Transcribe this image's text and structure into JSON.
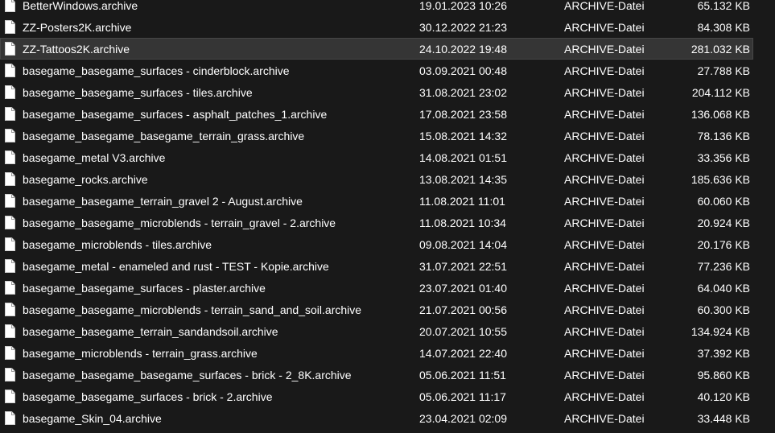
{
  "files": [
    {
      "name": "BetterWindows.archive",
      "date": "19.01.2023 10:26",
      "type": "ARCHIVE-Datei",
      "size": "65.132 KB",
      "selected": false
    },
    {
      "name": "ZZ-Posters2K.archive",
      "date": "30.12.2022 21:23",
      "type": "ARCHIVE-Datei",
      "size": "84.308 KB",
      "selected": false
    },
    {
      "name": "ZZ-Tattoos2K.archive",
      "date": "24.10.2022 19:48",
      "type": "ARCHIVE-Datei",
      "size": "281.032 KB",
      "selected": true
    },
    {
      "name": "basegame_basegame_surfaces - cinderblock.archive",
      "date": "03.09.2021 00:48",
      "type": "ARCHIVE-Datei",
      "size": "27.788 KB",
      "selected": false
    },
    {
      "name": "basegame_basegame_surfaces - tiles.archive",
      "date": "31.08.2021 23:02",
      "type": "ARCHIVE-Datei",
      "size": "204.112 KB",
      "selected": false
    },
    {
      "name": "basegame_basegame_surfaces - asphalt_patches_1.archive",
      "date": "17.08.2021 23:58",
      "type": "ARCHIVE-Datei",
      "size": "136.068 KB",
      "selected": false
    },
    {
      "name": "basegame_basegame_basegame_terrain_grass.archive",
      "date": "15.08.2021 14:32",
      "type": "ARCHIVE-Datei",
      "size": "78.136 KB",
      "selected": false
    },
    {
      "name": "basegame_metal V3.archive",
      "date": "14.08.2021 01:51",
      "type": "ARCHIVE-Datei",
      "size": "33.356 KB",
      "selected": false
    },
    {
      "name": "basegame_rocks.archive",
      "date": "13.08.2021 14:35",
      "type": "ARCHIVE-Datei",
      "size": "185.636 KB",
      "selected": false
    },
    {
      "name": "basegame_basegame_terrain_gravel 2 - August.archive",
      "date": "11.08.2021 11:01",
      "type": "ARCHIVE-Datei",
      "size": "60.060 KB",
      "selected": false
    },
    {
      "name": "basegame_basegame_microblends - terrain_gravel - 2.archive",
      "date": "11.08.2021 10:34",
      "type": "ARCHIVE-Datei",
      "size": "20.924 KB",
      "selected": false
    },
    {
      "name": "basegame_microblends - tiles.archive",
      "date": "09.08.2021 14:04",
      "type": "ARCHIVE-Datei",
      "size": "20.176 KB",
      "selected": false
    },
    {
      "name": "basegame_metal - enameled and rust - TEST - Kopie.archive",
      "date": "31.07.2021 22:51",
      "type": "ARCHIVE-Datei",
      "size": "77.236 KB",
      "selected": false
    },
    {
      "name": "basegame_basegame_surfaces - plaster.archive",
      "date": "23.07.2021 01:40",
      "type": "ARCHIVE-Datei",
      "size": "64.040 KB",
      "selected": false
    },
    {
      "name": "basegame_basegame_microblends - terrain_sand_and_soil.archive",
      "date": "21.07.2021 00:56",
      "type": "ARCHIVE-Datei",
      "size": "60.300 KB",
      "selected": false
    },
    {
      "name": "basegame_basegame_terrain_sandandsoil.archive",
      "date": "20.07.2021 10:55",
      "type": "ARCHIVE-Datei",
      "size": "134.924 KB",
      "selected": false
    },
    {
      "name": "basegame_microblends - terrain_grass.archive",
      "date": "14.07.2021 22:40",
      "type": "ARCHIVE-Datei",
      "size": "37.392 KB",
      "selected": false
    },
    {
      "name": "basegame_basegame_basegame_surfaces - brick - 2_8K.archive",
      "date": "05.06.2021 11:51",
      "type": "ARCHIVE-Datei",
      "size": "95.860 KB",
      "selected": false
    },
    {
      "name": "basegame_basegame_surfaces - brick - 2.archive",
      "date": "05.06.2021 11:17",
      "type": "ARCHIVE-Datei",
      "size": "40.120 KB",
      "selected": false
    },
    {
      "name": "basegame_Skin_04.archive",
      "date": "23.04.2021 02:09",
      "type": "ARCHIVE-Datei",
      "size": "33.448 KB",
      "selected": false
    }
  ],
  "colors": {
    "background": "#191919",
    "text": "#ffffff",
    "selected_row": "#353535",
    "selected_border": "#474747",
    "icon_fill": "#ffffff"
  },
  "icon": "file-icon"
}
